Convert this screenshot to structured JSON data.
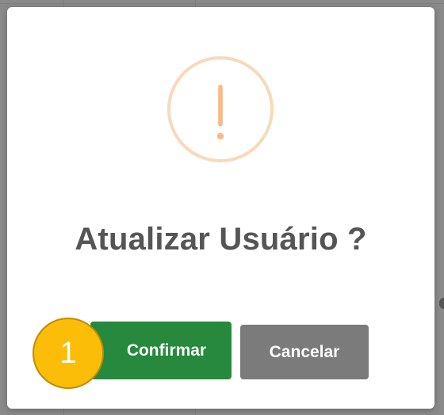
{
  "dialog": {
    "title": "Atualizar Usuário ?",
    "icon": "warning-exclamation-icon",
    "icon_color": "#f8bb86",
    "confirm_label": "Confirmar",
    "cancel_label": "Cancelar"
  },
  "step_badge": {
    "number": "1",
    "color": "#fbbd08"
  },
  "colors": {
    "confirm_button": "#26893d",
    "cancel_button": "#7b7b7b",
    "title_text": "#555555",
    "overlay": "#8a8a8a"
  }
}
